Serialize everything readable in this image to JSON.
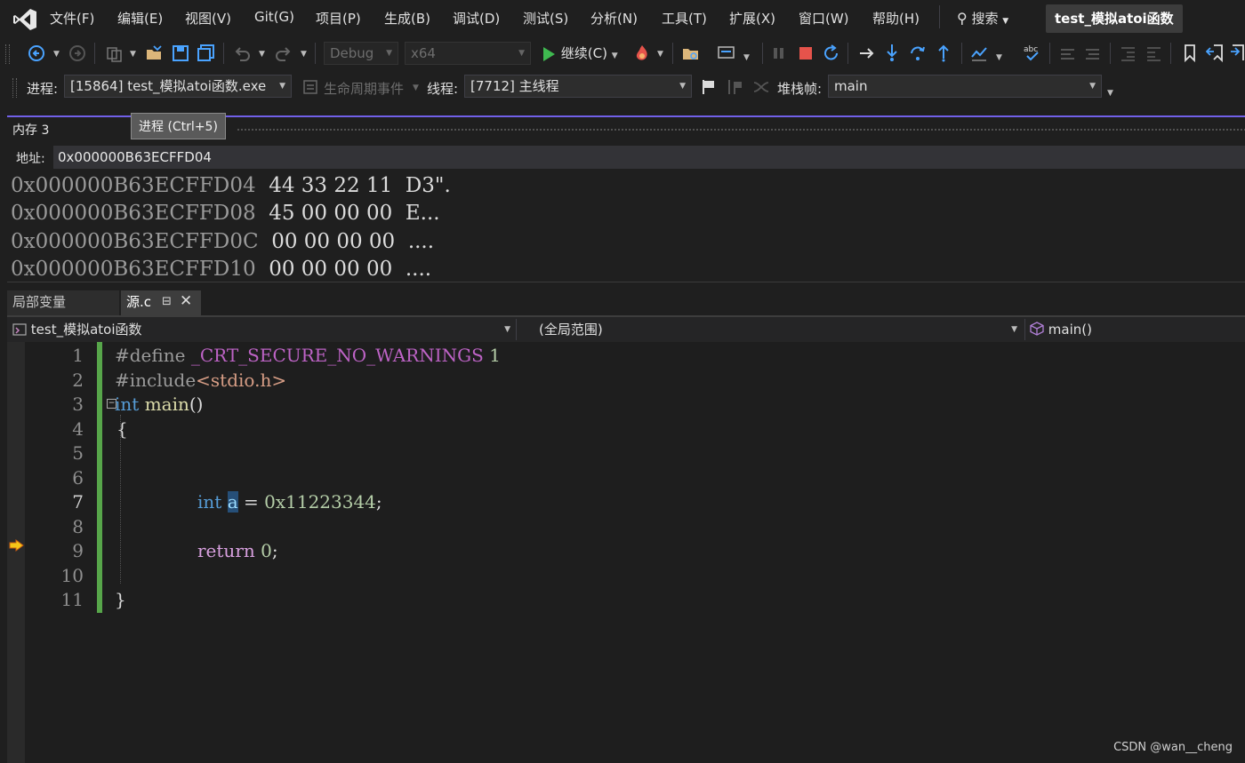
{
  "menubar": {
    "items": [
      "文件(F)",
      "编辑(E)",
      "视图(V)",
      "Git(G)",
      "项目(P)",
      "生成(B)",
      "调试(D)",
      "测试(S)",
      "分析(N)",
      "工具(T)",
      "扩展(X)",
      "窗口(W)",
      "帮助(H)"
    ],
    "search_label": "搜索",
    "solution_title": "test_模拟atoi函数"
  },
  "toolbar": {
    "config": "Debug",
    "platform": "x64",
    "continue_label": "继续(C)"
  },
  "debug_location": {
    "process_label": "进程:",
    "process_value": "[15864] test_模拟atoi函数.exe",
    "lifecycle_label": "生命周期事件",
    "thread_label": "线程:",
    "thread_value": "[7712] 主线程",
    "stackframe_label": "堆栈帧:",
    "stackframe_value": "main"
  },
  "memory_window": {
    "tab_title": "内存 3",
    "tooltip": "进程 (Ctrl+5)",
    "address_label": "地址:",
    "address_value": "0x000000B63ECFFD04",
    "rows": [
      {
        "addr": "0x000000B63ECFFD04",
        "bytes": "44 33 22 11",
        "chars": "D3\"."
      },
      {
        "addr": "0x000000B63ECFFD08",
        "bytes": "45 00 00 00",
        "chars": "E..."
      },
      {
        "addr": "0x000000B63ECFFD0C",
        "bytes": "00 00 00 00",
        "chars": "...."
      },
      {
        "addr": "0x000000B63ECFFD10",
        "bytes": "00 00 00 00",
        "chars": "...."
      }
    ]
  },
  "doc_tabs": {
    "locals": "局部变量",
    "source": "源.c"
  },
  "navbar": {
    "project": "test_模拟atoi函数",
    "scope": "(全局范围)",
    "member": "main()"
  },
  "editor": {
    "line_numbers": [
      "1",
      "2",
      "3",
      "4",
      "5",
      "6",
      "7",
      "8",
      "9",
      "10",
      "11"
    ],
    "current_line": 7,
    "next_statement_line": 9,
    "code": {
      "l1_directive": "#define",
      "l1_macro": "_CRT_SECURE_NO_WARNINGS",
      "l1_value": "1",
      "l2_directive": "#include",
      "l2_header": "<stdio.h>",
      "l3_type": "int",
      "l3_name": "main",
      "l3_parens": "()",
      "l4_brace": "{",
      "l7_type": "int",
      "l7_var": "a",
      "l7_assign": " = ",
      "l7_value": "0x11223344",
      "l7_semi": ";",
      "l9_ret": "return",
      "l9_value": "0",
      "l9_semi": ";",
      "l11_brace": "}"
    }
  },
  "watermark": "CSDN @wan__cheng"
}
